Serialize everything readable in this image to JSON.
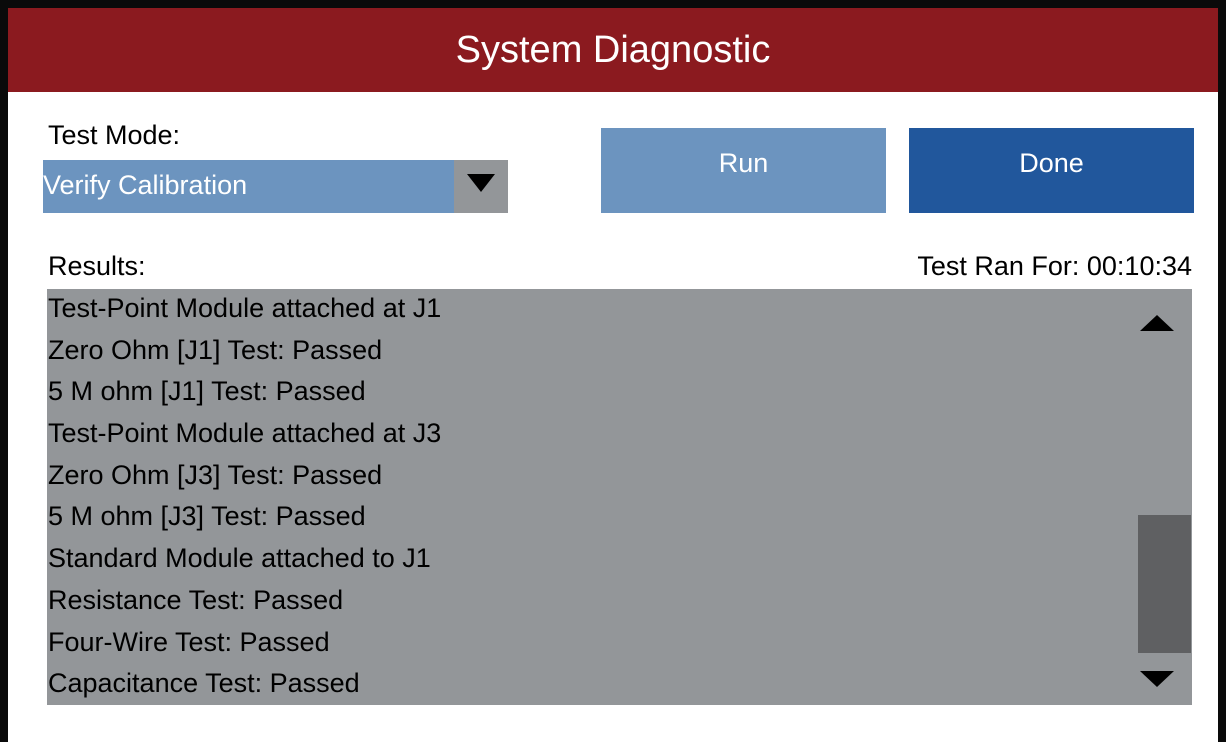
{
  "window": {
    "title": "System Diagnostic"
  },
  "test_mode": {
    "label": "Test Mode:",
    "selected": "Verify Calibration"
  },
  "buttons": {
    "run": "Run",
    "done": "Done"
  },
  "results": {
    "label": "Results:",
    "elapsed_label": "Test Ran For: 00:10:34",
    "lines": [
      "Test-Point Module attached at J1",
      "Zero Ohm [J1] Test: Passed",
      "5 M ohm [J1] Test:  Passed",
      "Test-Point Module attached at J3",
      "Zero Ohm [J3] Test:  Passed",
      "5 M ohm [J3] Test:  Passed",
      "Standard Module attached to J1",
      "Resistance Test:  Passed",
      "Four-Wire Test:  Passed",
      "Capacitance Test:  Passed"
    ]
  },
  "icons": {
    "dropdown": "chevron-down-icon",
    "scroll_up": "scroll-up-icon",
    "scroll_down": "scroll-down-icon"
  },
  "colors": {
    "title_bar": "#8b1a1f",
    "run_button": "#6c94bf",
    "done_button": "#21579c",
    "results_bg": "#939699"
  }
}
